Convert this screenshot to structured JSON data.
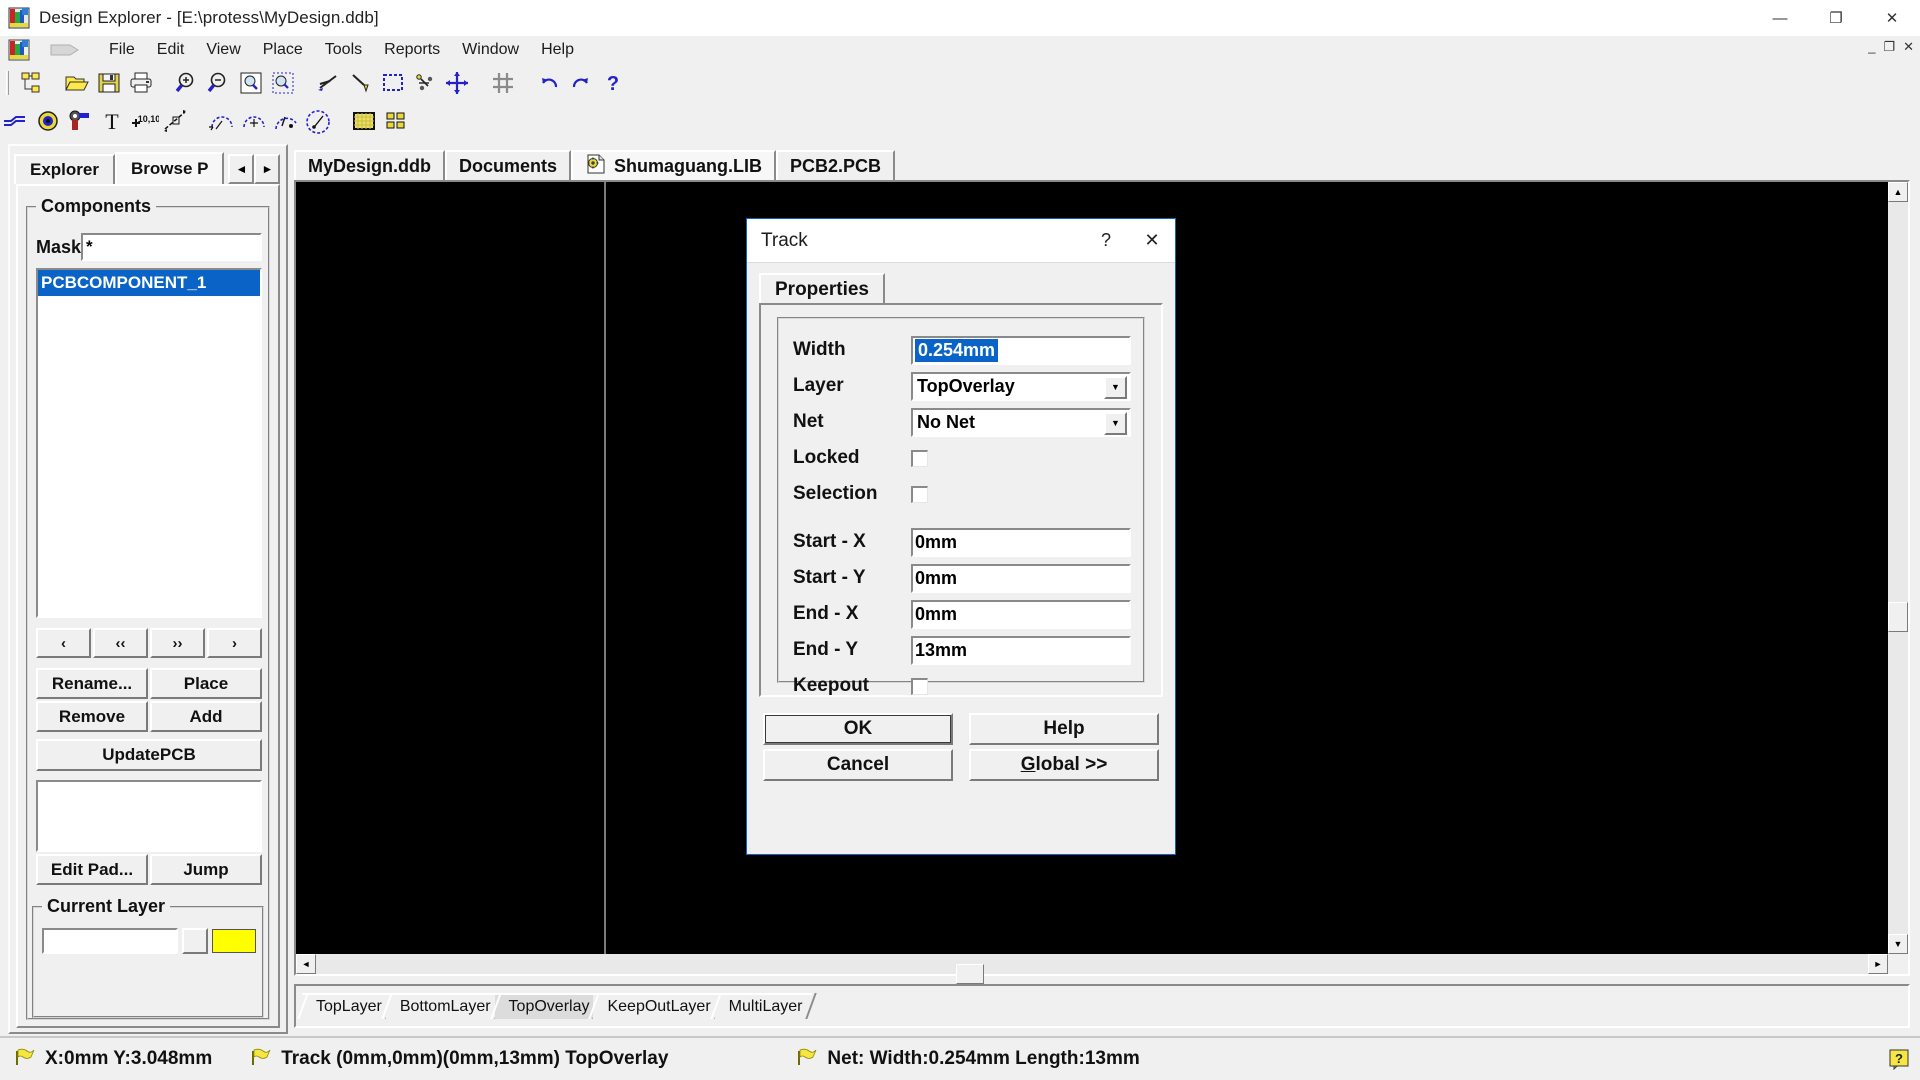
{
  "window": {
    "title": "Design Explorer - [E:\\protess\\MyDesign.ddb]",
    "icon": "design-explorer-icon",
    "minimize": "—",
    "maximize": "❐",
    "close": "✕",
    "mdi_minimize": "_",
    "mdi_restore": "❐",
    "mdi_close": "✕"
  },
  "menubar": {
    "items": [
      {
        "label": "File"
      },
      {
        "label": "Edit"
      },
      {
        "label": "View"
      },
      {
        "label": "Place"
      },
      {
        "label": "Tools"
      },
      {
        "label": "Reports"
      },
      {
        "label": "Window"
      },
      {
        "label": "Help"
      }
    ]
  },
  "toolbar_main": {
    "icons": [
      "design-hierarchy-icon",
      "open-folder-icon",
      "save-icon",
      "print-icon",
      "zoom-in-icon",
      "zoom-out-icon",
      "zoom-area-icon",
      "zoom-selection-icon",
      "cut-icon",
      "paste-icon",
      "select-area-icon",
      "move-selection-icon",
      "move-icon",
      "toggle-grid-icon",
      "undo-icon",
      "redo-icon",
      "help-icon"
    ]
  },
  "toolbar_placement": {
    "icons": [
      "place-track-icon",
      "place-pad-icon",
      "place-via-icon",
      "place-string-icon",
      "place-coordinate-icon",
      "place-dimension-icon",
      "place-arc-center-icon",
      "place-arc-edge-icon",
      "place-arc-any-icon",
      "place-full-circle-icon",
      "place-fill-icon",
      "place-array-icon"
    ]
  },
  "sidebar": {
    "tabs": [
      {
        "label": "Explorer",
        "active": false
      },
      {
        "label": "Browse P",
        "active": true
      }
    ],
    "tab_prev": "◄",
    "tab_next": "►",
    "group_title": "Components",
    "mask_label": "Mask",
    "mask_value": "*",
    "list_items": [
      {
        "label": "PCBCOMPONENT_1",
        "selected": true
      }
    ],
    "nav_buttons": [
      {
        "label": "‹"
      },
      {
        "label": "‹‹"
      },
      {
        "label": "››"
      },
      {
        "label": "›"
      }
    ],
    "action_buttons_row1": [
      {
        "label": "Rename..."
      },
      {
        "label": "Place"
      }
    ],
    "action_buttons_row2": [
      {
        "label": "Remove"
      },
      {
        "label": "Add"
      }
    ],
    "update_button": "UpdatePCB",
    "pad_buttons": [
      {
        "label": "Edit Pad..."
      },
      {
        "label": "Jump"
      }
    ],
    "current_layer_title": "Current Layer",
    "current_layer_value": "",
    "current_layer_color": "#ffff00"
  },
  "document_tabs": [
    {
      "label": "MyDesign.ddb",
      "icon": "",
      "active": false
    },
    {
      "label": "Documents",
      "icon": "",
      "active": false
    },
    {
      "label": "Shumaguang.LIB",
      "icon": "library-document-icon",
      "active": true
    },
    {
      "label": "PCB2.PCB",
      "icon": "",
      "active": false
    }
  ],
  "canvas": {
    "background_color": "#000000",
    "scroll_up": "▲",
    "scroll_down": "▼",
    "scroll_left": "◄",
    "scroll_right": "►"
  },
  "layer_tabs": [
    {
      "label": "TopLayer",
      "active": false
    },
    {
      "label": "BottomLayer",
      "active": false
    },
    {
      "label": "TopOverlay",
      "active": true
    },
    {
      "label": "KeepOutLayer",
      "active": false
    },
    {
      "label": "MultiLayer",
      "active": false
    }
  ],
  "statusbar": {
    "segments": [
      {
        "icon": "flag-icon",
        "text": "X:0mm Y:3.048mm"
      },
      {
        "icon": "flag-icon",
        "text": "Track (0mm,0mm)(0mm,13mm)  TopOverlay"
      },
      {
        "icon": "flag-icon",
        "text": "Net: Width:0.254mm Length:13mm"
      }
    ],
    "help_icon": "context-help-icon"
  },
  "dialog": {
    "title": "Track",
    "help_btn": "?",
    "close_btn": "✕",
    "tab": "Properties",
    "fields": {
      "width_label": "Width",
      "width_value": "0.254mm",
      "layer_label": "Layer",
      "layer_value": "TopOverlay",
      "net_label": "Net",
      "net_value": "No Net",
      "locked_label": "Locked",
      "locked_checked": false,
      "selection_label": "Selection",
      "selection_checked": false,
      "start_x_label": "Start - X",
      "start_x_value": "0mm",
      "start_y_label": "Start - Y",
      "start_y_value": "0mm",
      "end_x_label": "End - X",
      "end_x_value": "0mm",
      "end_y_label": "End - Y",
      "end_y_value": "13mm",
      "keepout_label": "Keepout",
      "keepout_checked": false
    },
    "buttons": {
      "ok": "OK",
      "help": "Help",
      "cancel": "Cancel",
      "global_prefix": "G",
      "global_rest": "lobal >>"
    },
    "dropdown_arrow": "▼"
  }
}
